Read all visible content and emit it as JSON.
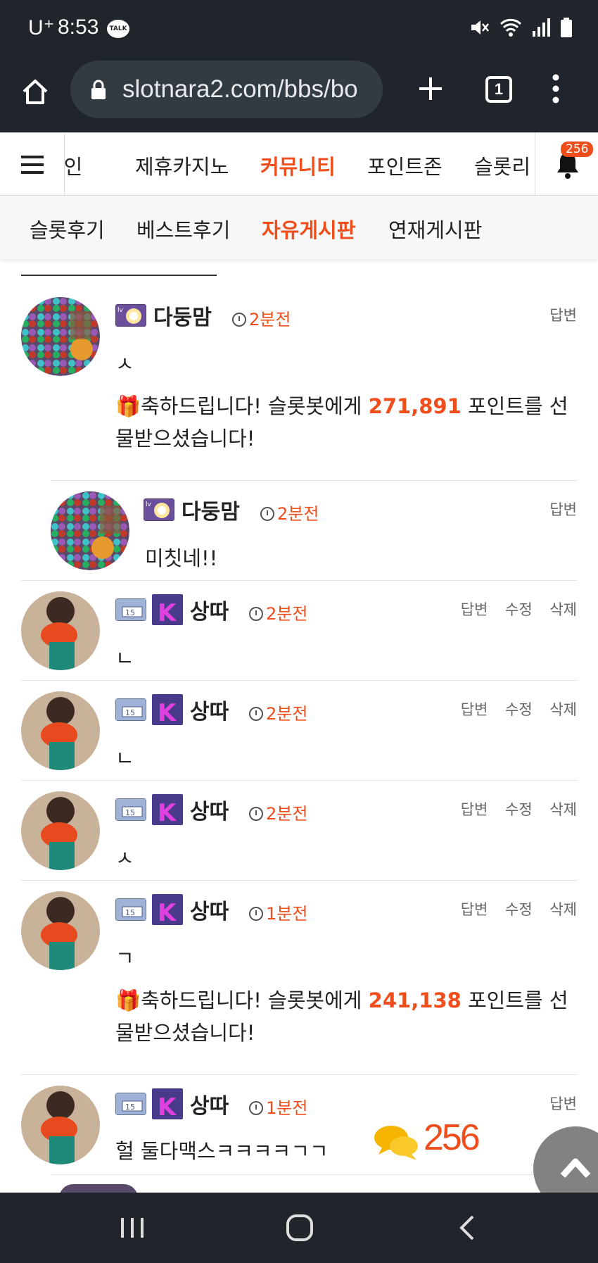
{
  "status_bar": {
    "carrier": "U⁺",
    "time": "8:53",
    "talk_label": "TALK"
  },
  "browser": {
    "url": "slotnara2.com/bbs/bo",
    "tab_count": "1"
  },
  "site_nav": {
    "items": [
      "메인",
      "제휴카지노",
      "커뮤니티",
      "포인트존",
      "슬롯리"
    ],
    "active": "커뮤니티",
    "notification_count": "256"
  },
  "sub_nav": {
    "items": [
      "슬롯후기",
      "베스트후기",
      "자유게시판",
      "연재게시판"
    ],
    "active": "자유게시판"
  },
  "comments": [
    {
      "author": "다둥맘",
      "ago": "2분전",
      "text": "ㅅ",
      "actions": [
        "답변"
      ],
      "gift": {
        "prefix": "축하드립니다! 슬롯봇에게 ",
        "points": "271,891",
        "suffix": " 포인트를 선물받으셨습니다!"
      }
    },
    {
      "author": "다둥맘",
      "ago": "2분전",
      "text": "미칫네!!",
      "actions": [
        "답변"
      ],
      "reply": true
    },
    {
      "author": "상따",
      "ago": "2분전",
      "text": "ㄴ",
      "actions": [
        "답변",
        "수정",
        "삭제"
      ]
    },
    {
      "author": "상따",
      "ago": "2분전",
      "text": "ㄴ",
      "actions": [
        "답변",
        "수정",
        "삭제"
      ]
    },
    {
      "author": "상따",
      "ago": "2분전",
      "text": "ㅅ",
      "actions": [
        "답변",
        "수정",
        "삭제"
      ]
    },
    {
      "author": "상따",
      "ago": "1분전",
      "text": "ㄱ",
      "actions": [
        "답변",
        "수정",
        "삭제"
      ],
      "gift": {
        "prefix": "축하드립니다! 슬롯봇에게 ",
        "points": "241,138",
        "suffix": " 포인트를 선물받으셨습니다!"
      }
    },
    {
      "author": "상따",
      "ago": "1분전",
      "text": "헐 둘다맥스ㅋㅋㅋㅋㄱㄱ",
      "actions": [
        "답변"
      ]
    }
  ],
  "floating_chat_count": "256",
  "colors": {
    "accent": "#ef4e1c",
    "dark_bar": "#1f252b"
  }
}
